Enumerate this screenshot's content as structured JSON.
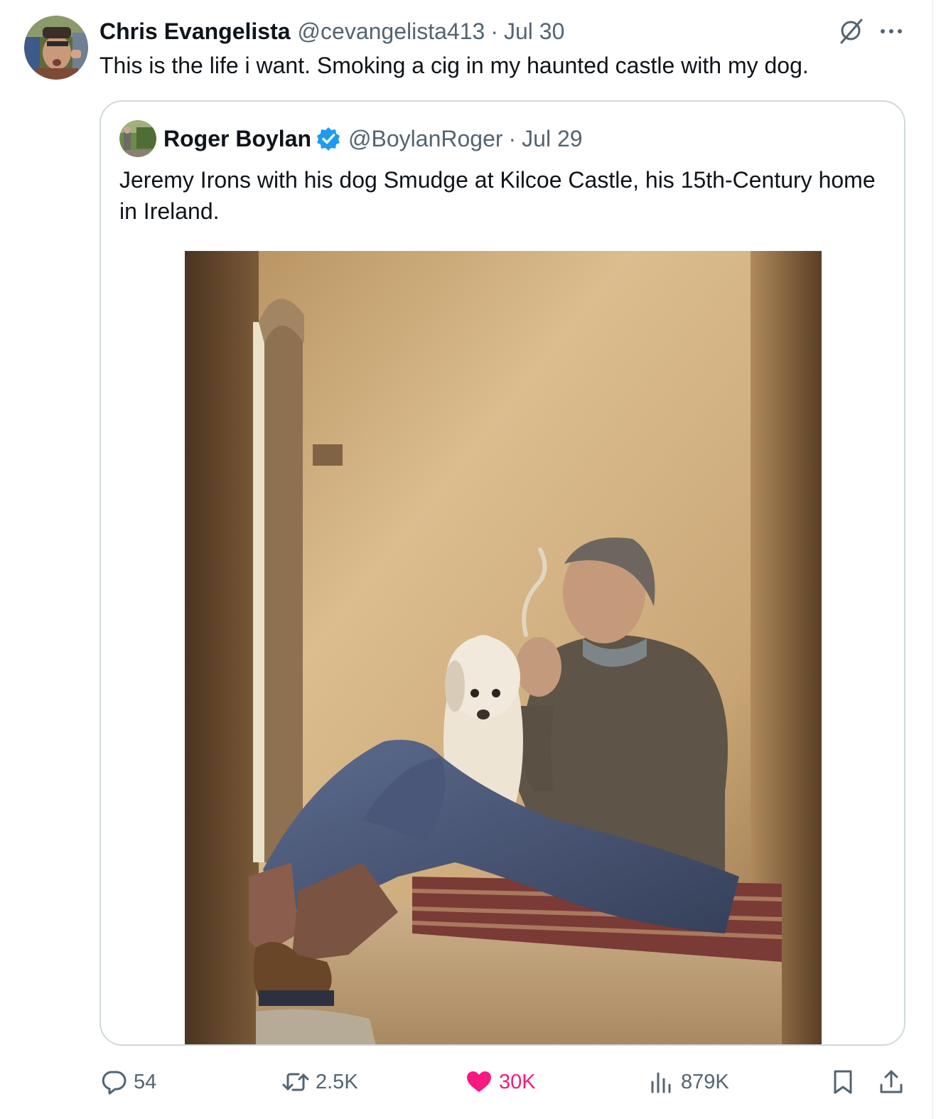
{
  "tweet": {
    "author": {
      "name": "Chris Evangelista",
      "handle": "@cevangelista413",
      "separator": "·",
      "date": "Jul 30"
    },
    "text": "This is the life i want. Smoking a cig in my haunted castle with my dog.",
    "header_icons": [
      "grok-icon",
      "more-icon"
    ]
  },
  "quote": {
    "author": {
      "name": "Roger Boylan",
      "verified": true,
      "handle": "@BoylanRoger",
      "separator": "·",
      "date": "Jul 29"
    },
    "text": "Jeremy Irons with his dog Smudge at Kilcoe Castle, his 15th-Century home in Ireland."
  },
  "actions": {
    "replies": "54",
    "reposts": "2.5K",
    "likes": "30K",
    "views": "879K",
    "icons": [
      "reply-icon",
      "repost-icon",
      "heart-icon",
      "views-icon",
      "bookmark-icon",
      "share-icon"
    ]
  },
  "colors": {
    "text_primary": "#0f1419",
    "text_secondary": "#536471",
    "like_active": "#f91880",
    "verified_blue": "#1d9bf0",
    "border": "#cfd9de"
  }
}
